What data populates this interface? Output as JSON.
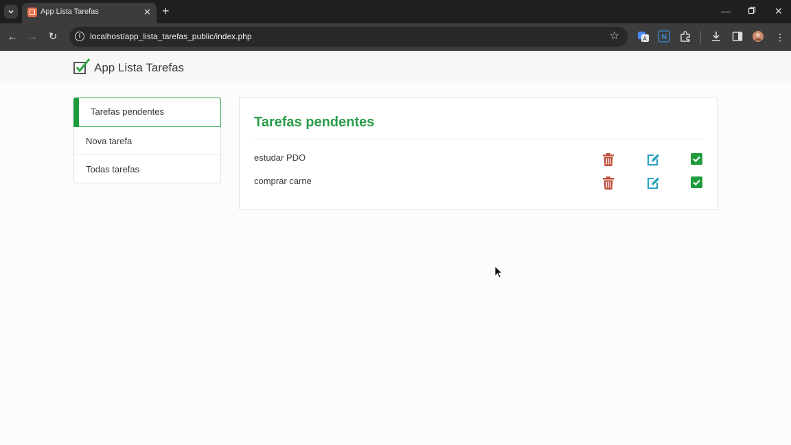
{
  "browser": {
    "tab_title": "App Lista Tarefas",
    "url": "localhost/app_lista_tarefas_public/index.php"
  },
  "app": {
    "brand": "App Lista Tarefas"
  },
  "menu": {
    "items": [
      {
        "label": "Tarefas pendentes",
        "active": true
      },
      {
        "label": "Nova tarefa",
        "active": false
      },
      {
        "label": "Todas tarefas",
        "active": false
      }
    ]
  },
  "panel": {
    "title": "Tarefas pendentes",
    "tasks": [
      {
        "text": "estudar PDO"
      },
      {
        "text": "comprar carne"
      }
    ]
  },
  "colors": {
    "accent_green": "#1e9b3c",
    "delete_red": "#c0503e",
    "edit_blue": "#27a1c0",
    "check_green": "#1e9b3c"
  }
}
